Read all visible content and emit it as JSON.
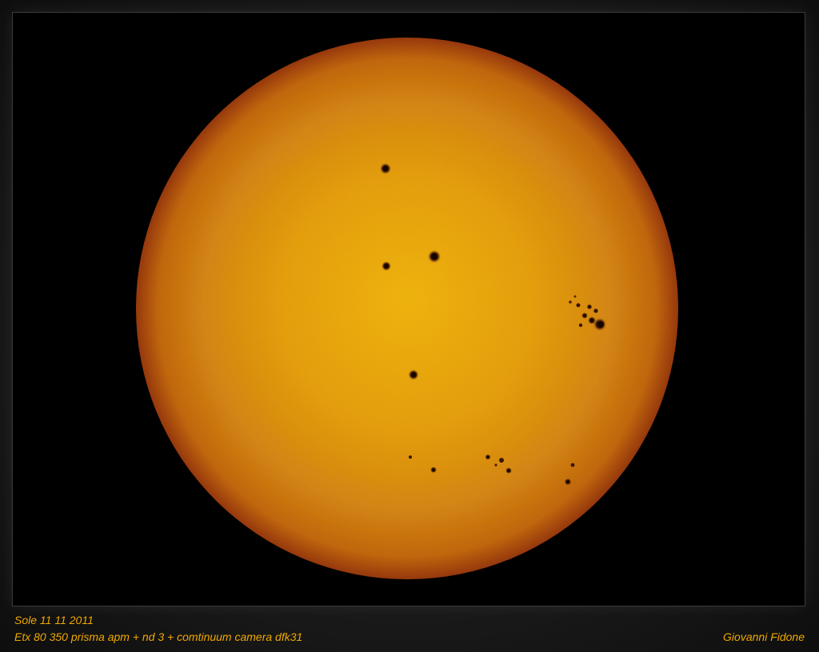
{
  "caption": {
    "title": "Sole 11 11 2011",
    "equipment": "Etx 80 350 prisma apm + nd 3 + comtinuum camera dfk31",
    "author": "Giovanni Fidone"
  },
  "colors": {
    "caption_text": "#f0a800",
    "sun_center": "#f2b20c",
    "sun_mid": "#e09412",
    "sun_limb": "#b4480c",
    "background": "#000000"
  }
}
